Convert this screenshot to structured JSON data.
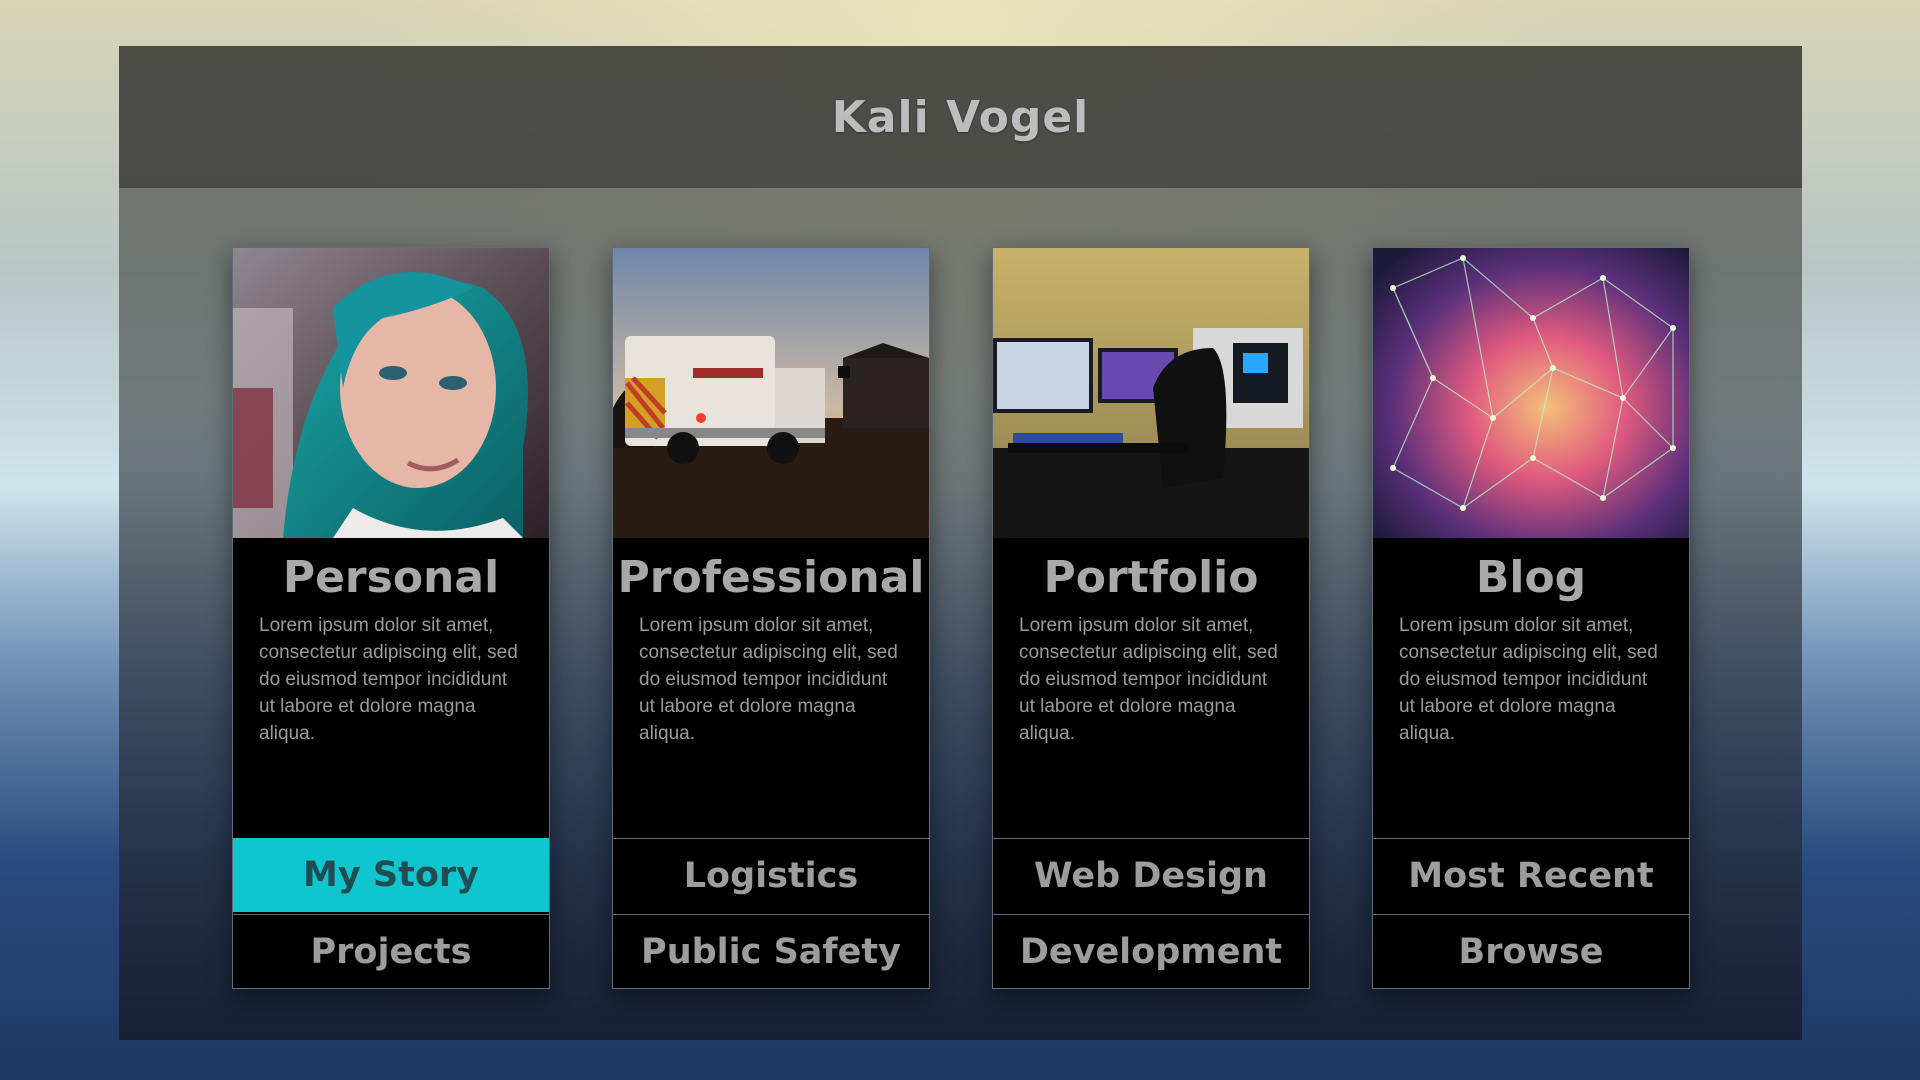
{
  "header": {
    "title": "Kali Vogel"
  },
  "cards": [
    {
      "title": "Personal",
      "description": "Lorem ipsum dolor sit amet, consectetur adipiscing elit, sed do eiusmod tempor incididunt ut labore et dolore magna aliqua.",
      "links": [
        "My Story",
        "Projects"
      ],
      "active_link": "My Story",
      "accent": "#0fc5ce"
    },
    {
      "title": "Professional",
      "description": "Lorem ipsum dolor sit amet, consectetur adipiscing elit, sed do eiusmod tempor incididunt ut labore et dolore magna aliqua.",
      "links": [
        "Logistics",
        "Public Safety"
      ]
    },
    {
      "title": "Portfolio",
      "description": "Lorem ipsum dolor sit amet, consectetur adipiscing elit, sed do eiusmod tempor incididunt ut labore et dolore magna aliqua.",
      "links": [
        "Web Design",
        "Development"
      ]
    },
    {
      "title": "Blog",
      "description": "Lorem ipsum dolor sit amet, consectetur adipiscing elit, sed do eiusmod tempor incididunt ut labore et dolore magna aliqua.",
      "links": [
        "Most Recent",
        "Browse"
      ]
    }
  ]
}
